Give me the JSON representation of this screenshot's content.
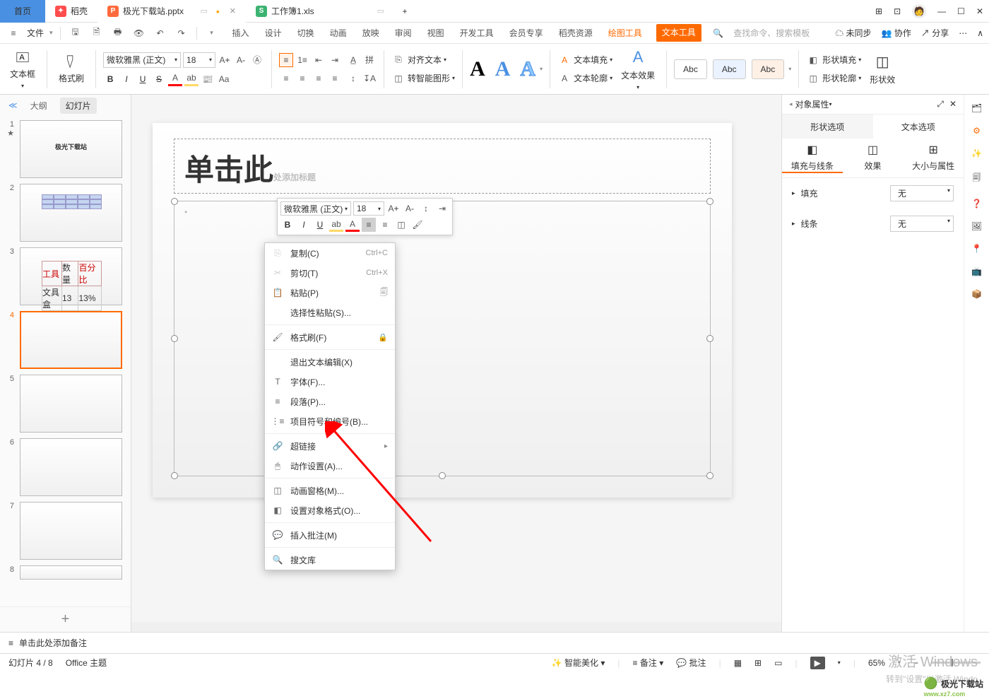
{
  "titlebar": {
    "tabs": [
      {
        "label": "首页",
        "type": "home"
      },
      {
        "label": "稻壳",
        "icon": "dk",
        "iconColor": "#ff4d4d"
      },
      {
        "label": "极光下载站.pptx",
        "icon": "P",
        "iconColor": "#ff6a3c",
        "active": true
      },
      {
        "label": "工作簿1.xls",
        "icon": "S",
        "iconColor": "#3cb371"
      }
    ],
    "avatarLetter": "🧑"
  },
  "qat": {
    "fileLabel": "文件",
    "menus": [
      "插入",
      "设计",
      "切换",
      "动画",
      "放映",
      "审阅",
      "视图",
      "开发工具",
      "会员专享",
      "稻壳资源"
    ],
    "drawTool": "绘图工具",
    "textTool": "文本工具",
    "searchPlaceholder": "查找命令、搜索模板",
    "unsync": "未同步",
    "collab": "协作",
    "share": "分享"
  },
  "ribbon": {
    "textbox": "文本框",
    "formatBrush": "格式刷",
    "fontName": "微软雅黑 (正文)",
    "fontSize": "18",
    "alignText": "对齐文本",
    "smartGraphic": "转智能图形",
    "textFill": "文本填充",
    "textOutline": "文本轮廓",
    "textEffect": "文本效果",
    "shapeFill": "形状填充",
    "shapeOutline": "形状轮廓",
    "shapeEffect": "形状效",
    "styleBoxes": [
      "Abc",
      "Abc",
      "Abc"
    ]
  },
  "slidepanel": {
    "outline": "大纲",
    "slides": "幻灯片",
    "thumb1Title": "极光下载站"
  },
  "slide": {
    "titlePlaceholder": "单击此处添加标题"
  },
  "miniToolbar": {
    "font": "微软雅黑 (正文)",
    "size": "18"
  },
  "contextMenu": {
    "copy": {
      "label": "复制(C)",
      "shortcut": "Ctrl+C"
    },
    "cut": {
      "label": "剪切(T)",
      "shortcut": "Ctrl+X"
    },
    "paste": {
      "label": "粘贴(P)"
    },
    "pasteSpecial": {
      "label": "选择性粘贴(S)..."
    },
    "formatBrush": {
      "label": "格式刷(F)"
    },
    "exitTextEdit": {
      "label": "退出文本编辑(X)"
    },
    "font": {
      "label": "字体(F)..."
    },
    "paragraph": {
      "label": "段落(P)..."
    },
    "bullets": {
      "label": "项目符号和编号(B)..."
    },
    "hyperlink": {
      "label": "超链接"
    },
    "action": {
      "label": "动作设置(A)..."
    },
    "animPane": {
      "label": "动画窗格(M)..."
    },
    "formatObj": {
      "label": "设置对象格式(O)..."
    },
    "insertComment": {
      "label": "插入批注(M)"
    },
    "souwenku": {
      "label": "搜文库"
    }
  },
  "rightPanel": {
    "title": "对象属性",
    "shapeOpt": "形状选项",
    "textOpt": "文本选项",
    "fillLine": "填充与线条",
    "effect": "效果",
    "sizeProp": "大小与属性",
    "fill": "填充",
    "line": "线条",
    "none": "无"
  },
  "notes": {
    "placeholder": "单击此处添加备注"
  },
  "status": {
    "slideInfo": "幻灯片 4 / 8",
    "theme": "Office 主题",
    "smartBeautify": "智能美化",
    "noteBtn": "备注",
    "comment": "批注",
    "zoom": "65%"
  },
  "watermark": {
    "line1": "激活 Windows",
    "line2": "转到\"设置\"以激活 Windo",
    "logo": "极光下载站",
    "logoUrl": "www.xz7.com"
  }
}
